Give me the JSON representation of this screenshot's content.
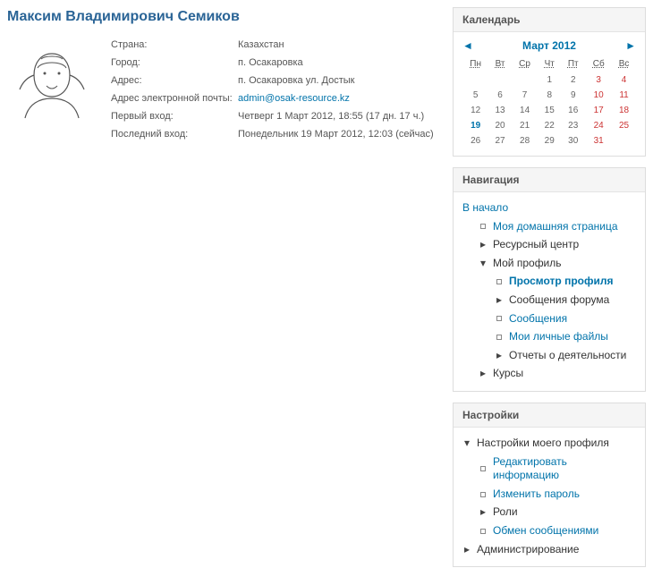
{
  "profile": {
    "name": "Максим Владимирович Семиков",
    "fields": {
      "country_label": "Страна:",
      "country_value": "Казахстан",
      "city_label": "Город:",
      "city_value": "п. Осакаровка",
      "address_label": "Адрес:",
      "address_value": "п. Осакаровка ул. Достык",
      "email_label": "Адрес электронной почты:",
      "email_value": "admin@osak-resource.kz",
      "first_login_label": "Первый вход:",
      "first_login_value": "Четверг 1 Март 2012, 18:55  (17 дн. 17 ч.)",
      "last_login_label": "Последний вход:",
      "last_login_value": "Понедельник 19 Март 2012, 12:03  (сейчас)"
    }
  },
  "calendar": {
    "title": "Календарь",
    "month": "Март 2012",
    "today": 19,
    "dow": [
      "Пн",
      "Вт",
      "Ср",
      "Чт",
      "Пт",
      "Сб",
      "Вс"
    ],
    "weeks": [
      [
        "",
        "",
        "",
        1,
        2,
        3,
        4
      ],
      [
        5,
        6,
        7,
        8,
        9,
        10,
        11
      ],
      [
        12,
        13,
        14,
        15,
        16,
        17,
        18
      ],
      [
        19,
        20,
        21,
        22,
        23,
        24,
        25
      ],
      [
        26,
        27,
        28,
        29,
        30,
        31,
        ""
      ]
    ]
  },
  "navigation": {
    "title": "Навигация",
    "home": "В начало",
    "my_home": "Моя домашняя страница",
    "resource_center": "Ресурсный центр",
    "my_profile": "Мой профиль",
    "view_profile": "Просмотр профиля",
    "forum_posts": "Сообщения форума",
    "messages": "Сообщения",
    "my_files": "Мои личные файлы",
    "activity_reports": "Отчеты о деятельности",
    "courses": "Курсы"
  },
  "settings": {
    "title": "Настройки",
    "my_profile_settings": "Настройки моего профиля",
    "edit_info": "Редактировать информацию",
    "change_password": "Изменить пароль",
    "roles": "Роли",
    "messaging": "Обмен сообщениями",
    "administration": "Администрирование"
  }
}
